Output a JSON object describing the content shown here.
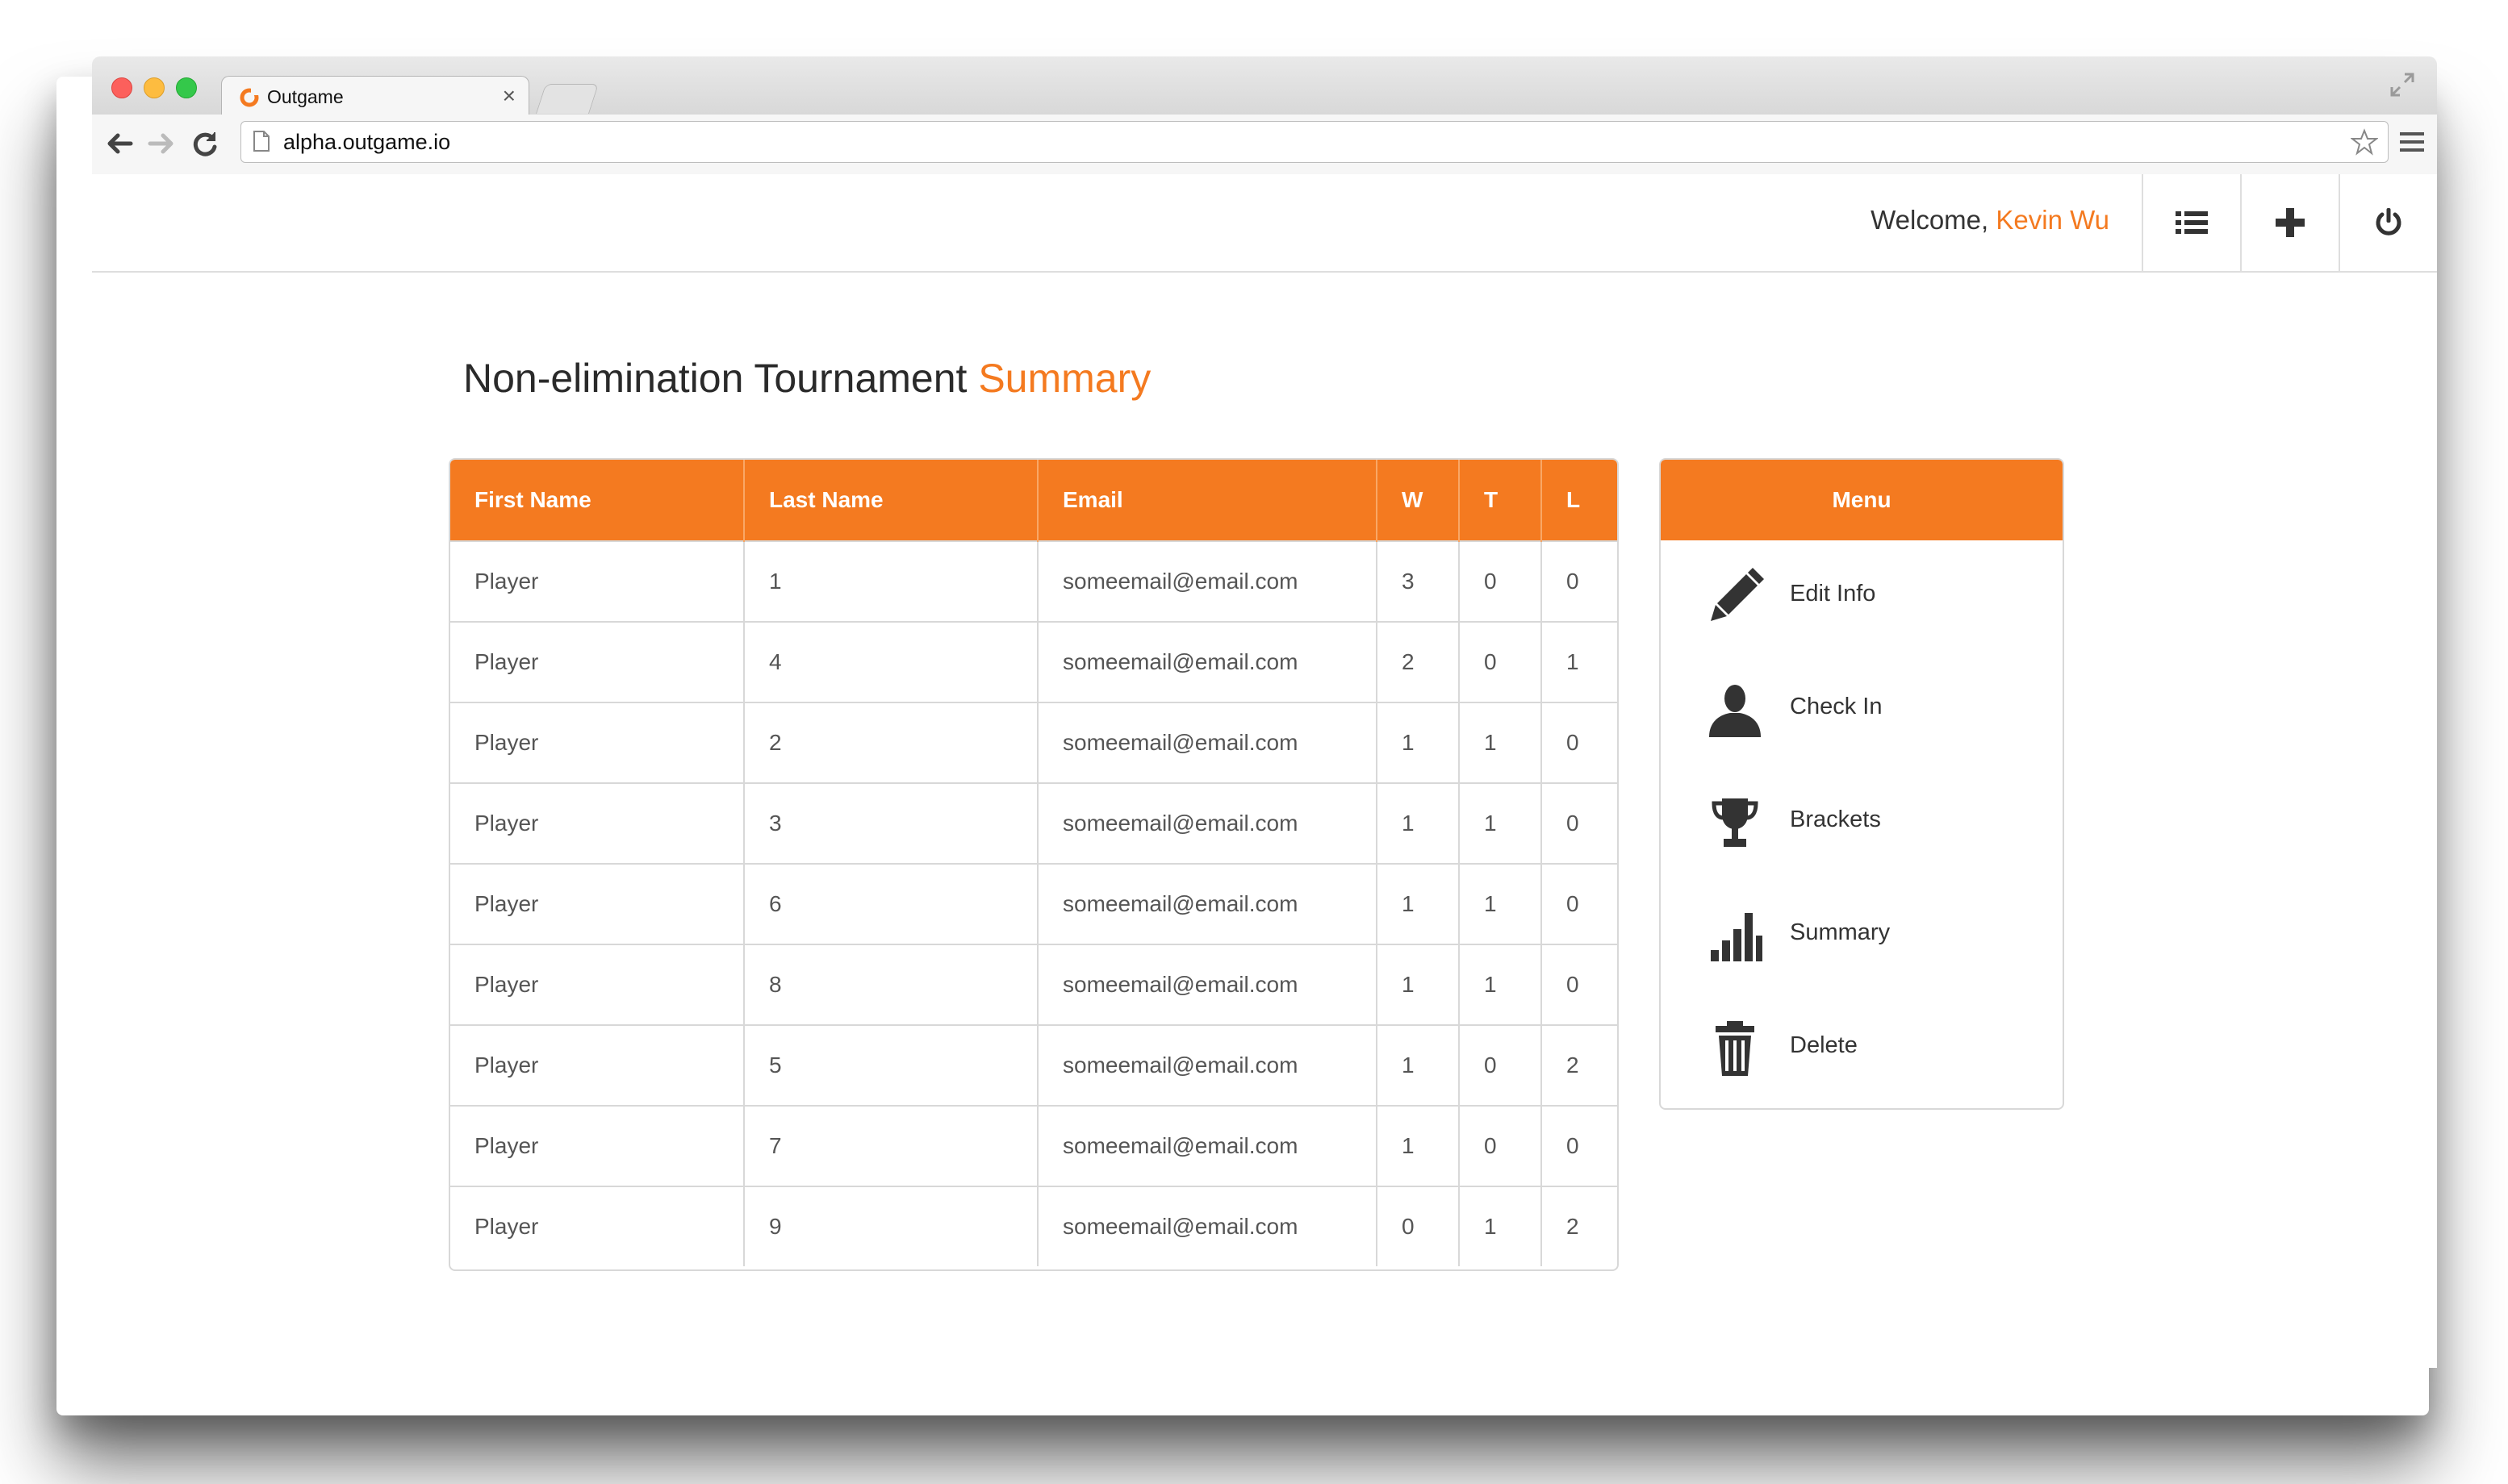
{
  "browser": {
    "tab_title": "Outgame",
    "tab_close": "×",
    "url": "alpha.outgame.io"
  },
  "topnav": {
    "welcome_prefix": "Welcome, ",
    "user_name": "Kevin Wu",
    "buttons": [
      "list-icon",
      "plus-icon",
      "power-icon"
    ]
  },
  "page": {
    "title_main": "Non-elimination Tournament ",
    "title_accent": "Summary"
  },
  "table": {
    "headers": [
      "First Name",
      "Last Name",
      "Email",
      "W",
      "T",
      "L"
    ],
    "rows": [
      [
        "Player",
        "1",
        "someemail@email.com",
        "3",
        "0",
        "0"
      ],
      [
        "Player",
        "4",
        "someemail@email.com",
        "2",
        "0",
        "1"
      ],
      [
        "Player",
        "2",
        "someemail@email.com",
        "1",
        "1",
        "0"
      ],
      [
        "Player",
        "3",
        "someemail@email.com",
        "1",
        "1",
        "0"
      ],
      [
        "Player",
        "6",
        "someemail@email.com",
        "1",
        "1",
        "0"
      ],
      [
        "Player",
        "8",
        "someemail@email.com",
        "1",
        "1",
        "0"
      ],
      [
        "Player",
        "5",
        "someemail@email.com",
        "1",
        "0",
        "2"
      ],
      [
        "Player",
        "7",
        "someemail@email.com",
        "1",
        "0",
        "0"
      ],
      [
        "Player",
        "9",
        "someemail@email.com",
        "0",
        "1",
        "2"
      ]
    ]
  },
  "menu": {
    "title": "Menu",
    "items": [
      {
        "label": "Edit Info",
        "icon": "pencil-icon"
      },
      {
        "label": "Check In",
        "icon": "person-icon"
      },
      {
        "label": "Brackets",
        "icon": "trophy-icon"
      },
      {
        "label": "Summary",
        "icon": "bar-chart-icon"
      },
      {
        "label": "Delete",
        "icon": "trash-icon"
      }
    ]
  },
  "colors": {
    "accent": "#f47a20",
    "text": "#333333"
  }
}
